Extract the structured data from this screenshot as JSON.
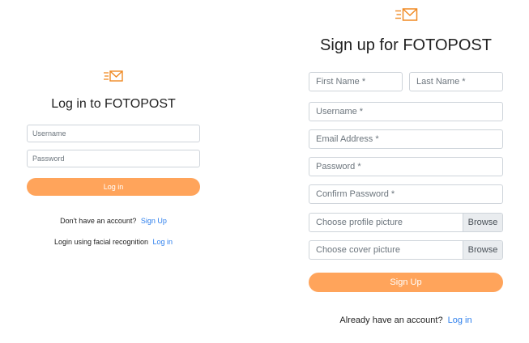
{
  "brand": {
    "logo_icon": "envelope-speed-icon",
    "accent": "#ffa45b",
    "link_color": "#2f80ed"
  },
  "login": {
    "title": "Log in to FOTOPOST",
    "username_placeholder": "Username",
    "password_placeholder": "Password",
    "submit_label": "Log in",
    "no_account_text": "Don't have an account?",
    "signup_link": "Sign Up",
    "facial_text": "Login using facial recognition",
    "facial_link": "Log in"
  },
  "signup": {
    "title": "Sign up for FOTOPOST",
    "first_name_placeholder": "First Name *",
    "last_name_placeholder": "Last Name *",
    "username_placeholder": "Username *",
    "email_placeholder": "Email Address *",
    "password_placeholder": "Password *",
    "confirm_password_placeholder": "Confirm Password *",
    "profile_picture_label": "Choose profile picture",
    "cover_picture_label": "Choose cover picture",
    "browse_label": "Browse",
    "submit_label": "Sign Up",
    "have_account_text": "Already have an account?",
    "login_link": "Log in"
  }
}
